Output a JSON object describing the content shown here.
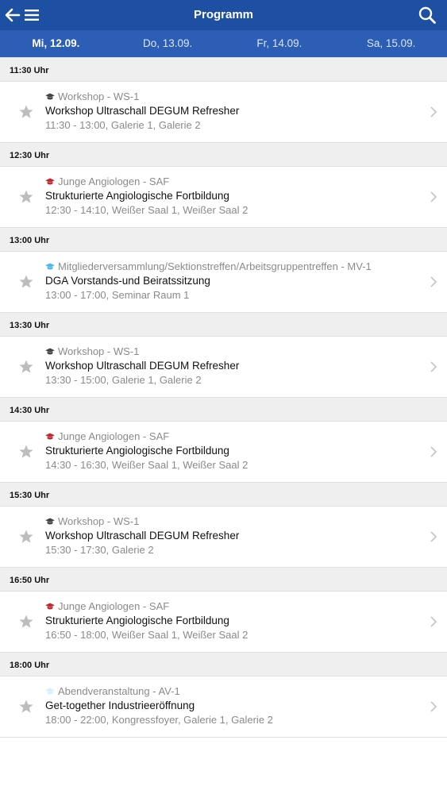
{
  "navbar": {
    "title": "Programm",
    "back_icon": "arrow-left-icon",
    "menu_icon": "hamburger-icon",
    "search_icon": "search-icon"
  },
  "days": [
    {
      "label": "Mi, 12.09.",
      "active": true
    },
    {
      "label": "Do, 13.09.",
      "active": false
    },
    {
      "label": "Fr, 14.09.",
      "active": false
    },
    {
      "label": "Sa, 15.09.",
      "active": false
    }
  ],
  "colors": {
    "navbar": "#1d4fa3",
    "daybar": "#2c5eb5",
    "workshop": "#444444",
    "junge": "#c0282d",
    "mitglieder": "#4ab8e8",
    "abend": "#d8f0f8"
  },
  "slots": [
    {
      "time": "11:30 Uhr",
      "sessions": [
        {
          "category": "Workshop - WS-1",
          "cat_color": "#444444",
          "title": "Workshop Ultraschall DEGUM Refresher",
          "details": "11:30 - 13:00, Galerie 1, Galerie 2"
        }
      ]
    },
    {
      "time": "12:30 Uhr",
      "sessions": [
        {
          "category": "Junge Angiologen - SAF",
          "cat_color": "#c0282d",
          "title": "Strukturierte Angiologische Fortbildung",
          "details": "12:30 - 14:10, Weißer Saal 1, Weißer Saal 2"
        }
      ]
    },
    {
      "time": "13:00 Uhr",
      "sessions": [
        {
          "category": "Mitgliederversammlung/Sektionstreffen/Arbeitsgruppentreffen - MV-1",
          "cat_color": "#4ab8e8",
          "title": "DGA Vorstands-und Beiratssitzung",
          "details": "13:00 - 17:00, Seminar Raum 1"
        }
      ]
    },
    {
      "time": "13:30 Uhr",
      "sessions": [
        {
          "category": "Workshop - WS-1",
          "cat_color": "#444444",
          "title": "Workshop Ultraschall DEGUM Refresher",
          "details": "13:30 - 15:00, Galerie 1, Galerie 2"
        }
      ]
    },
    {
      "time": "14:30 Uhr",
      "sessions": [
        {
          "category": "Junge Angiologen - SAF",
          "cat_color": "#c0282d",
          "title": "Strukturierte Angiologische Fortbildung",
          "details": "14:30 - 16:30, Weißer Saal 1, Weißer Saal 2"
        }
      ]
    },
    {
      "time": "15:30 Uhr",
      "sessions": [
        {
          "category": "Workshop - WS-1",
          "cat_color": "#444444",
          "title": "Workshop Ultraschall DEGUM Refresher",
          "details": "15:30 - 17:30, Galerie 2"
        }
      ]
    },
    {
      "time": "16:50 Uhr",
      "sessions": [
        {
          "category": "Junge Angiologen - SAF",
          "cat_color": "#c0282d",
          "title": "Strukturierte Angiologische Fortbildung",
          "details": "16:50 - 18:00, Weißer Saal 1, Weißer Saal 2"
        }
      ]
    },
    {
      "time": "18:00 Uhr",
      "sessions": [
        {
          "category": "Abendveranstaltung - AV-1",
          "cat_color": "#d8f0f8",
          "title": "Get-together Industrieeröffnung",
          "details": "18:00 - 22:00, Kongressfoyer, Galerie 1, Galerie 2"
        }
      ]
    }
  ]
}
